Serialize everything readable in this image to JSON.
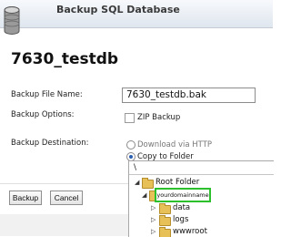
{
  "dialog": {
    "title": "Backup SQL Database",
    "database_name": "7630_testdb"
  },
  "form": {
    "backup_file_name_label": "Backup File Name:",
    "backup_file_name_value": "7630_testdb.bak",
    "backup_options_label": "Backup Options:",
    "zip_backup_label": "ZIP Backup",
    "zip_backup_checked": false,
    "backup_destination_label": "Backup Destination:",
    "destination_options": [
      {
        "label": "Download via HTTP",
        "selected": false
      },
      {
        "label": "Copy to Folder",
        "selected": true
      }
    ]
  },
  "folder_browser": {
    "path": "\\",
    "tree": {
      "root": "Root Folder",
      "domain": "yourdomainname",
      "children": [
        "data",
        "logs",
        "wwwroot"
      ]
    },
    "highlight_color": "#2cc02c"
  },
  "buttons": {
    "backup": "Backup",
    "cancel": "Cancel"
  }
}
